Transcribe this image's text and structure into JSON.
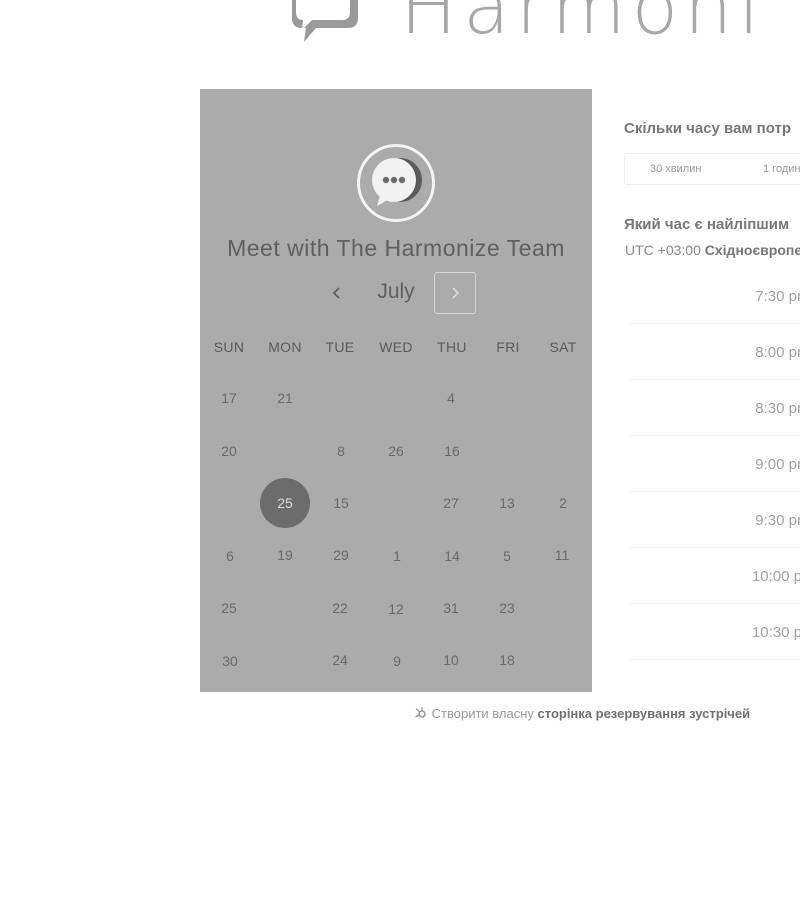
{
  "brand": {
    "name": "Harmoni"
  },
  "calendar": {
    "title": "Meet with The Harmonize Team",
    "month": "July",
    "weekdays": [
      "SUN",
      "MON",
      "TUE",
      "WED",
      "THU",
      "FRI",
      "SAT"
    ],
    "days": [
      "17",
      "21",
      "4",
      "20",
      "8",
      "26",
      "16",
      "25",
      "15",
      "27",
      "13",
      "2",
      "6",
      "19",
      "29",
      "1",
      "14",
      "5",
      "11",
      "25",
      "22",
      "12",
      "31",
      "23",
      "30",
      "24",
      "9",
      "10",
      "18"
    ],
    "selected_day": "25"
  },
  "booking": {
    "duration_question": "Скільки часу вам потр",
    "duration_options": [
      "30 хвилин",
      "1 годин"
    ],
    "time_question": "Який час є найліпшим",
    "timezone_offset": "UTC +03:00",
    "timezone_name": "Східноєвропе",
    "time_slots": [
      "7:30 pr",
      "8:00 pr",
      "8:30 pr",
      "9:00 pr",
      "9:30 pr",
      "10:00 p",
      "10:30 p"
    ]
  },
  "footer": {
    "prefix": "Створити власну",
    "link": "сторінка резервування зустрічей"
  }
}
